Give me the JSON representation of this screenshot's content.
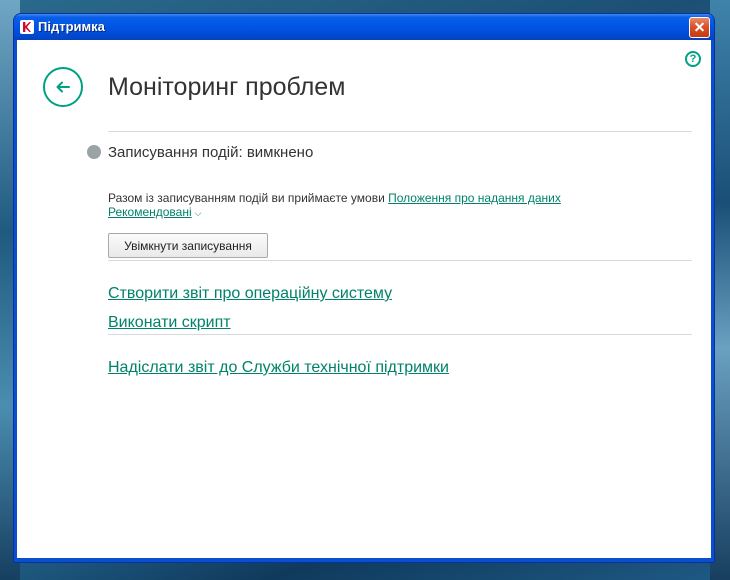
{
  "window": {
    "title": "Підтримка"
  },
  "header": {
    "page_title": "Моніторинг проблем"
  },
  "event_logging": {
    "status": "Записування подій: вимкнено",
    "consent_text": "Разом із записуванням подій ви приймаєте умови ",
    "consent_link": "Положення про надання даних",
    "recommended_link": "Рекомендовані",
    "enable_button": "Увімкнути записування"
  },
  "actions": {
    "os_report": "Створити звіт про операційну систему",
    "run_script": "Виконати скрипт",
    "send_report": "Надіслати звіт до Служби технічної підтримки"
  },
  "icons": {
    "app": "kaspersky-k-icon",
    "close": "close-icon",
    "help": "help-icon",
    "back": "arrow-left-icon",
    "status": "status-dot-icon",
    "chevron": "chevron-down-icon"
  },
  "colors": {
    "accent": "#00836a",
    "titlebar": "#0054e3",
    "status_off": "#9aa4a6"
  }
}
